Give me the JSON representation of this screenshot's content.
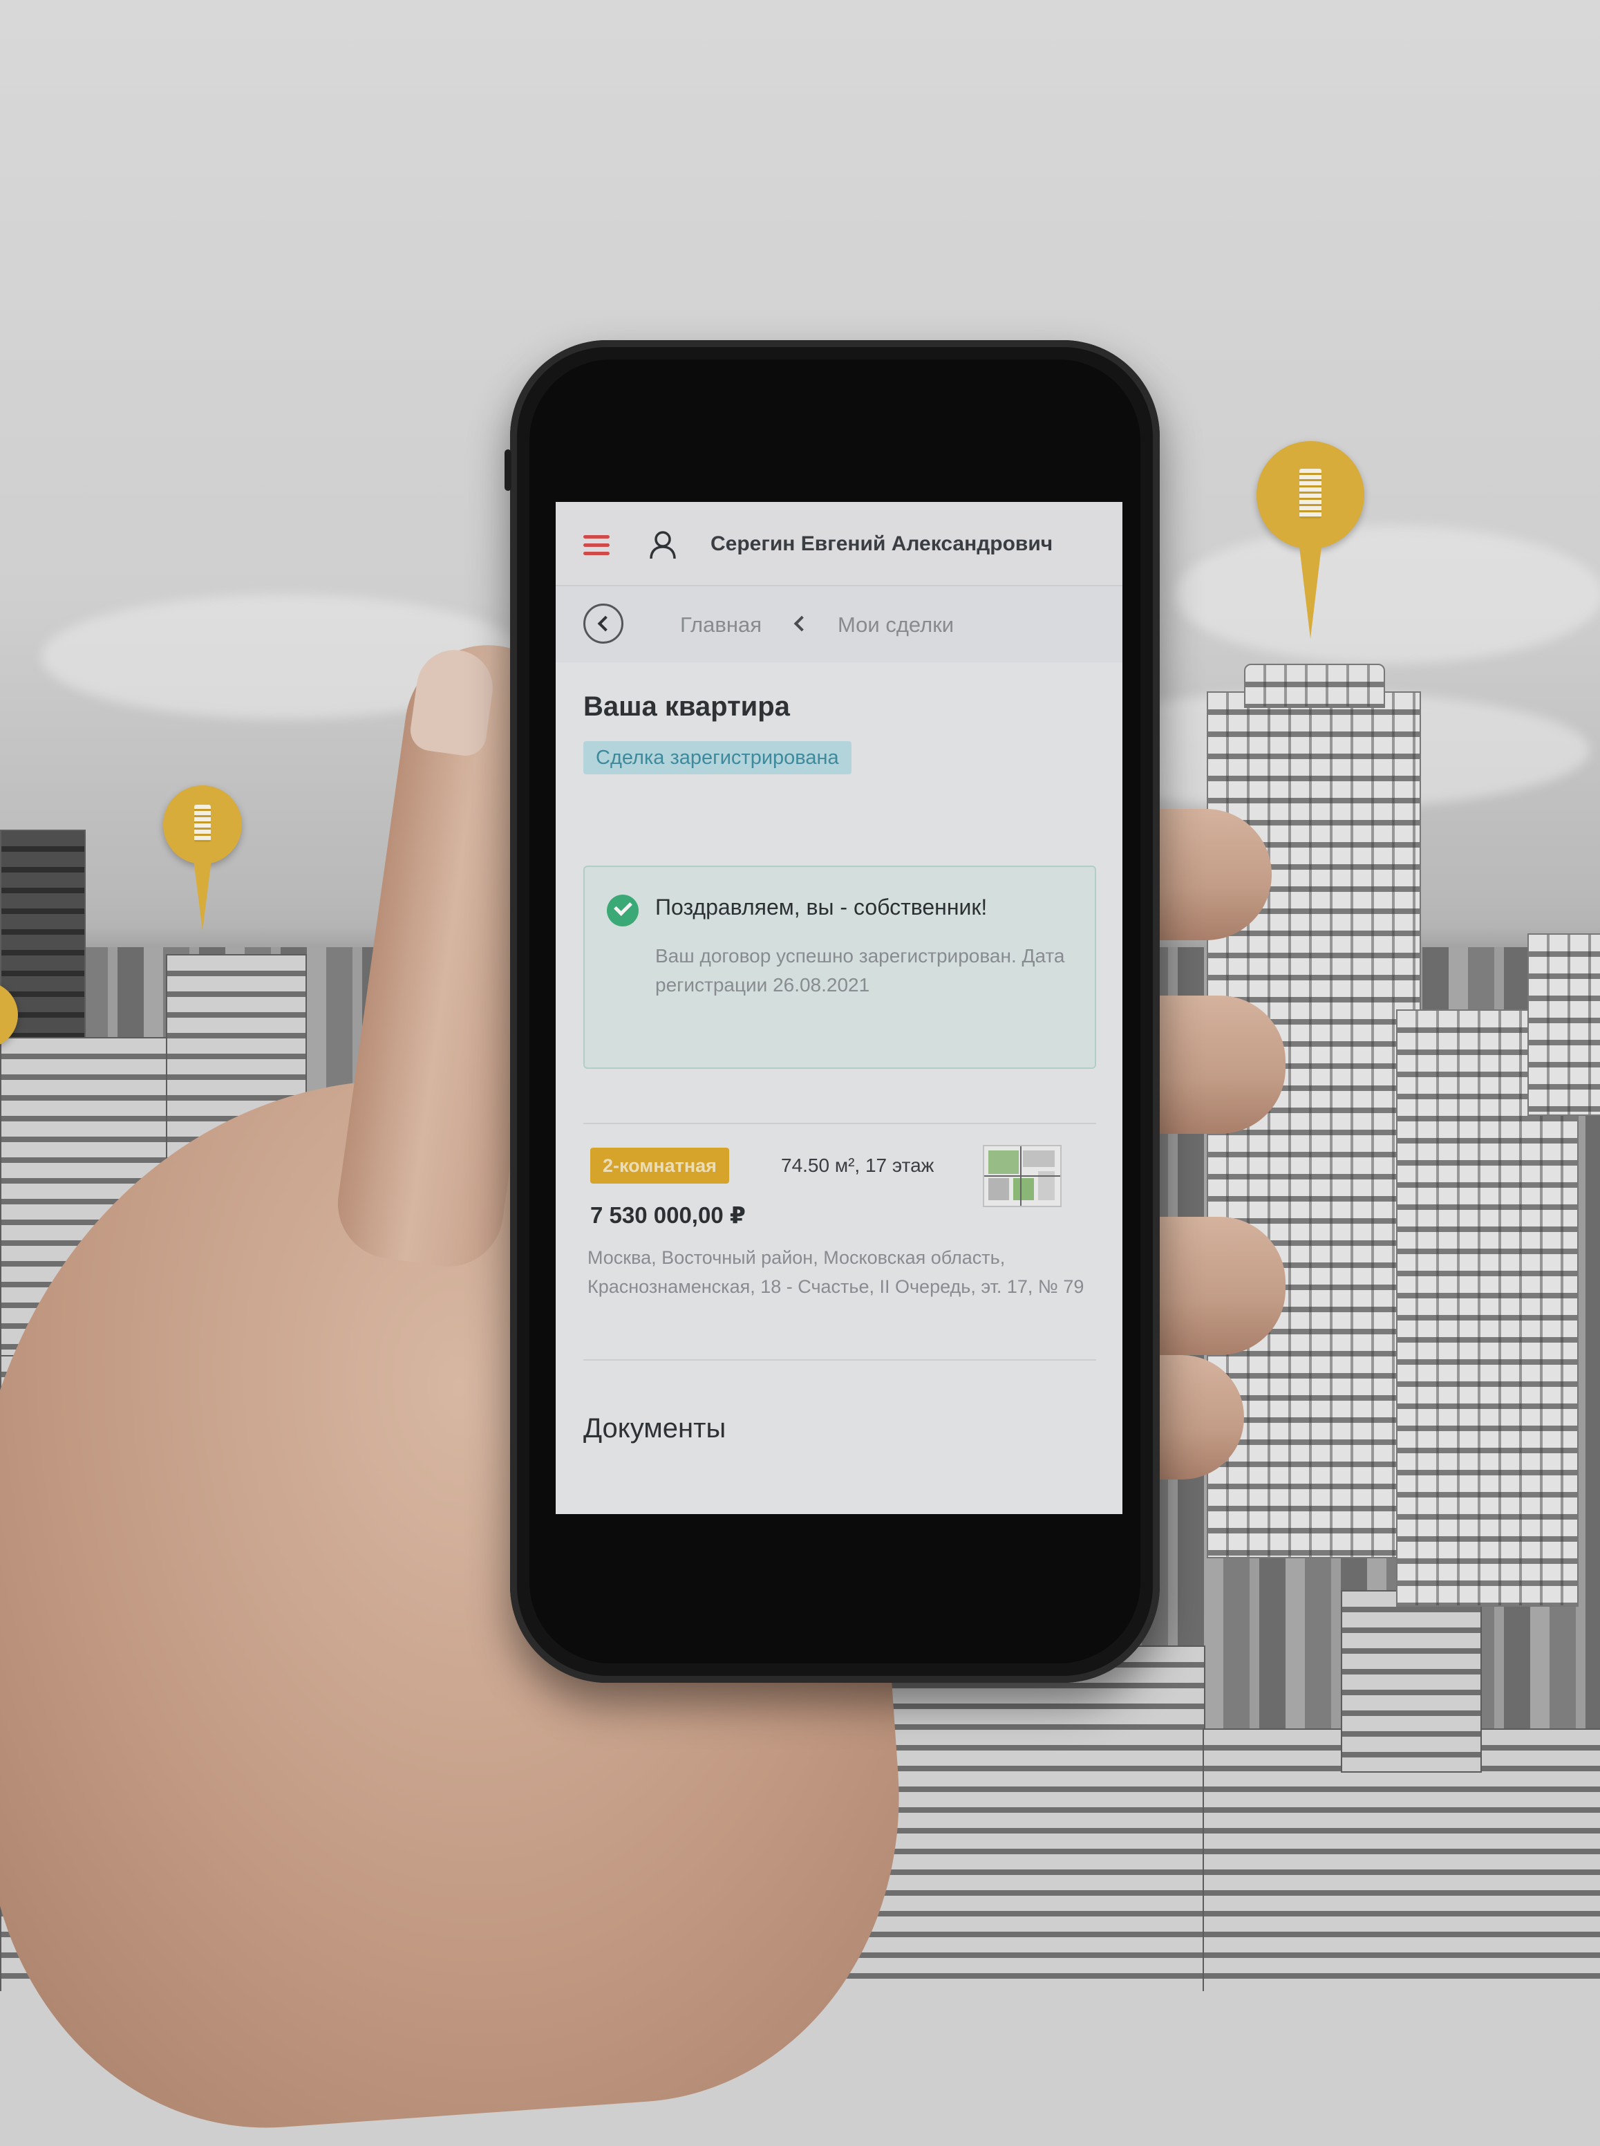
{
  "app": {
    "user_name": "Серегин Евгений Александрович",
    "menu_icon": "hamburger-icon",
    "user_icon": "user-icon"
  },
  "breadcrumb": {
    "back_icon": "chevron-left-icon",
    "home_label": "Главная",
    "separator_icon": "chevron-left-icon",
    "deals_label": "Мои сделки"
  },
  "main": {
    "title": "Ваша квартира",
    "status": "Сделка зарегистрирована",
    "notice": {
      "icon": "check-circle-icon",
      "title": "Поздравляем, вы - собственник!",
      "text": "Ваш договор успешно зарегистрирован. Дата регистрации 26.08.2021"
    },
    "apartment": {
      "rooms_badge": "2-комнатная",
      "area_floor": "74.50 м², 17 этаж",
      "price": "7 530 000,00 ₽",
      "address": "Москва, Восточный район, Московская область, Красноznаменская, 18 - Счастье, II Очередь, эт. 17, № 79",
      "plan_icon": "floor-plan-thumbnail"
    },
    "documents_title": "Документы"
  },
  "colors": {
    "accent_red": "#d94b4b",
    "status_bg": "#bcdde6",
    "status_text": "#3e8fa3",
    "success_green": "#3bb07a",
    "badge_yellow": "#e0a92a",
    "pin_gold": "#d8ac3a"
  }
}
